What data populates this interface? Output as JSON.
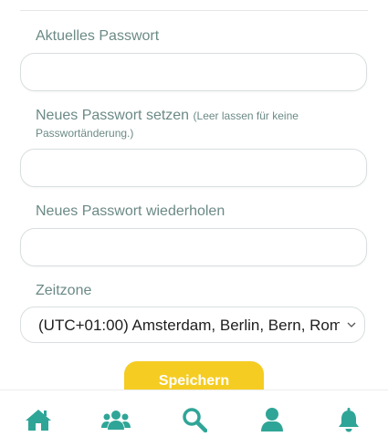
{
  "form": {
    "current_password": {
      "label": "Aktuelles Passwort",
      "value": ""
    },
    "new_password": {
      "label": "Neues Passwort setzen",
      "hint_part1": "(Leer lassen für keine",
      "hint_part2": "Passwortänderung.)",
      "value": ""
    },
    "repeat_password": {
      "label": "Neues Passwort wiederholen",
      "value": ""
    },
    "timezone": {
      "label": "Zeitzone",
      "selected": "(UTC+01:00) Amsterdam, Berlin, Bern, Rom"
    },
    "save_label": "Speichern"
  },
  "colors": {
    "accent": "#2fa597",
    "button": "#f5cc22",
    "label": "#6b8a86"
  },
  "bottom_nav": {
    "items": [
      {
        "name": "home",
        "icon": "home-icon"
      },
      {
        "name": "groups",
        "icon": "users-icon"
      },
      {
        "name": "search",
        "icon": "search-icon"
      },
      {
        "name": "profile",
        "icon": "user-icon"
      },
      {
        "name": "notifications",
        "icon": "bell-icon"
      }
    ]
  }
}
